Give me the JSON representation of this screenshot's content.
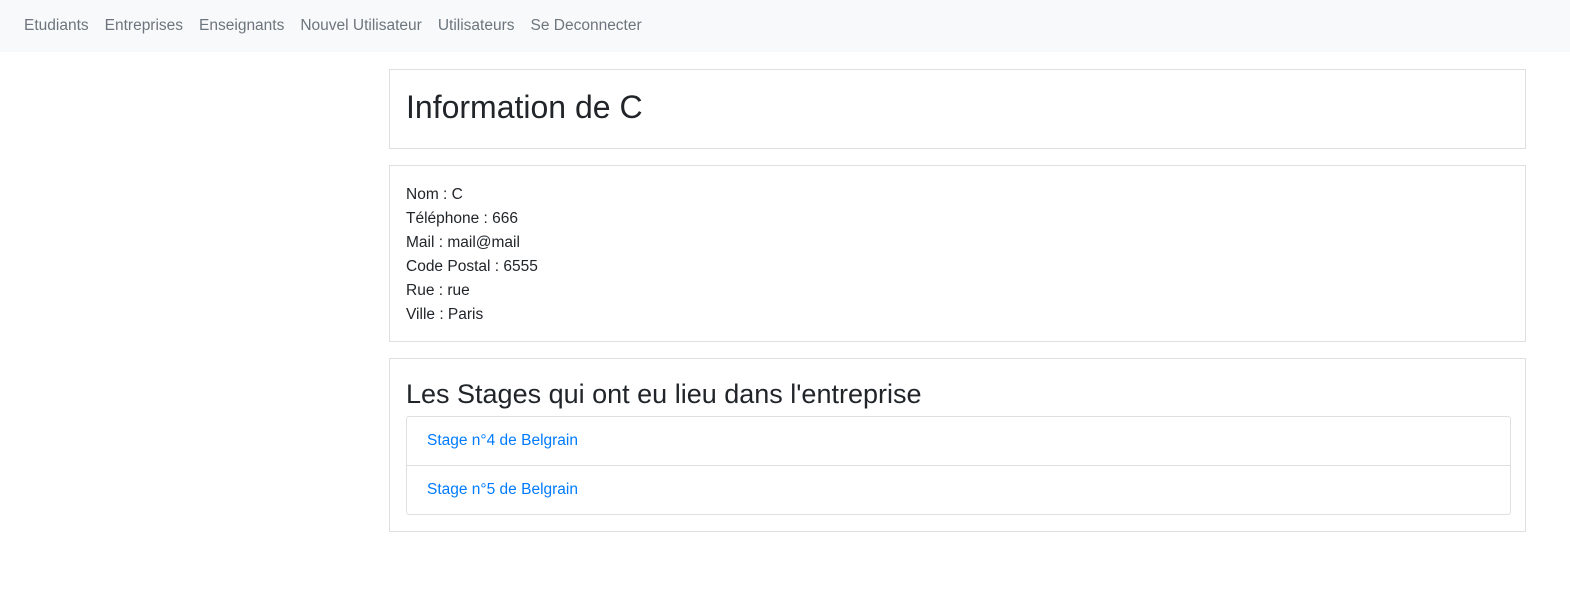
{
  "navbar": {
    "links": [
      "Etudiants",
      "Entreprises",
      "Enseignants",
      "Nouvel Utilisateur",
      "Utilisateurs",
      "Se Deconnecter"
    ]
  },
  "page": {
    "title": "Information de C"
  },
  "info": {
    "lines": [
      "Nom : C",
      "Téléphone : 666",
      "Mail : mail@mail",
      "Code Postal : 6555",
      "Rue : rue",
      "Ville : Paris"
    ]
  },
  "stages": {
    "title": "Les Stages qui ont eu lieu dans l'entreprise",
    "items": [
      "Stage n°4 de Belgrain",
      "Stage n°5 de Belgrain"
    ]
  },
  "colors": {
    "navbar_bg": "#f8f9fa",
    "nav_link": "#6c757d",
    "link": "#007bff",
    "border": "#dfdfdf"
  }
}
